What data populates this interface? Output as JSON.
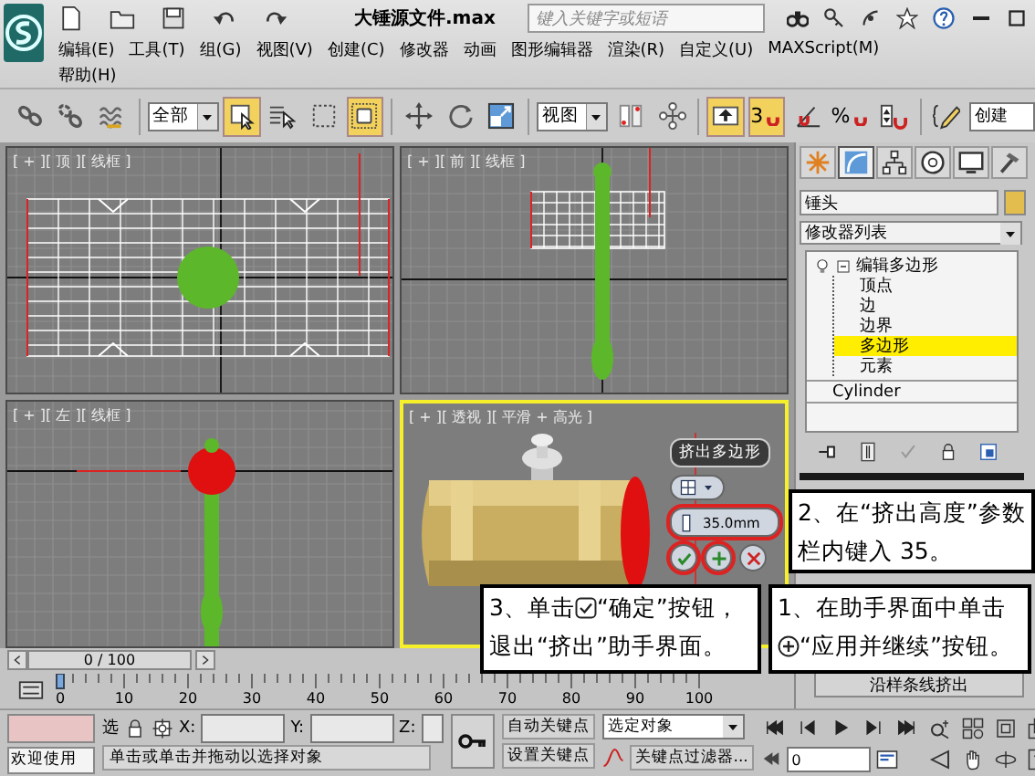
{
  "title_bar": {
    "title": "大锤源文件.max",
    "search": {
      "placeholder": "键入关键字或短语"
    }
  },
  "menu_rows": [
    [
      "编辑(E)",
      "工具(T)",
      "组(G)",
      "视图(V)",
      "创建(C)",
      "修改器",
      "动画",
      "图形编辑器",
      "渲染(R)",
      "自定义(U)",
      "MAXScript(M)"
    ],
    [
      "帮助(H)"
    ]
  ],
  "toolbar": [
    {
      "kind": "link",
      "active": false
    },
    {
      "kind": "unlink",
      "active": false
    },
    {
      "kind": "bind",
      "active": false
    },
    {
      "kind": "dropdown",
      "label": "全部"
    },
    {
      "kind": "select",
      "active": true
    },
    {
      "kind": "select-by-name",
      "active": false
    },
    {
      "kind": "region",
      "active": false
    },
    {
      "kind": "window-crossing",
      "active": true
    },
    {
      "kind": "move",
      "active": false
    },
    {
      "kind": "rotate",
      "active": false
    },
    {
      "kind": "scale",
      "active": false
    },
    {
      "kind": "dropdown",
      "label": "视图"
    },
    {
      "kind": "mirror",
      "active": false
    },
    {
      "kind": "align",
      "active": false
    },
    {
      "kind": "shortcut",
      "active": true
    },
    {
      "kind": "snap",
      "label": "3",
      "active": true
    },
    {
      "kind": "angle-snap",
      "active": false
    },
    {
      "kind": "percent-snap",
      "label": "%",
      "active": false
    },
    {
      "kind": "spinner-snap",
      "active": false
    },
    {
      "kind": "edit-named",
      "active": false
    },
    {
      "kind": "field",
      "label": "创建"
    }
  ],
  "viewports": [
    {
      "kind": "top",
      "label": "[ + ][ 顶 ][ 线框 ]",
      "active": false
    },
    {
      "kind": "front",
      "label": "[ + ][ 前 ][ 线框 ]",
      "active": false
    },
    {
      "kind": "left",
      "label": "[ + ][ 左 ][ 线框 ]",
      "active": false
    },
    {
      "kind": "perspective",
      "label": "[ + ][ 透视 ][ 平滑 + 高光 ]",
      "active": true
    }
  ],
  "caddy": {
    "title": "挤出多边形",
    "height": "35.0mm"
  },
  "time_slider": {
    "position": "0 / 100",
    "level": 0
  },
  "track_bar": {
    "ticks": [
      "0",
      "10",
      "20",
      "30",
      "40",
      "50",
      "60",
      "70",
      "80",
      "90",
      "100"
    ]
  },
  "command_panel": {
    "tabs": [
      {
        "kind": "create",
        "selected": false
      },
      {
        "kind": "modify",
        "selected": true
      },
      {
        "kind": "hierarchy",
        "selected": false
      },
      {
        "kind": "motion",
        "selected": false
      },
      {
        "kind": "display",
        "selected": false
      },
      {
        "kind": "utilities",
        "selected": false
      }
    ],
    "object_name": "锤头",
    "modifier_list": "修改器列表",
    "stack": [
      {
        "label": "编辑多边形",
        "expanded": true,
        "children": [
          {
            "label": "顶点",
            "selected": false
          },
          {
            "label": "边",
            "selected": false
          },
          {
            "label": "边界",
            "selected": false
          },
          {
            "label": "多边形",
            "selected": true
          },
          {
            "label": "元素",
            "selected": false
          }
        ]
      },
      {
        "label": "Cylinder"
      }
    ],
    "extrude_button": "沿样条线挤出"
  },
  "status_bar": {
    "welcome": "欢迎使用",
    "selection_lock": "选",
    "x_label": "X:",
    "y_label": "Y:",
    "z_label": "Z:",
    "prompt": "单击或单击并拖动以选择对象",
    "auto_key": "自动关键点",
    "set_key": "设置关键点",
    "key_target": "选定对象",
    "key_filters": "关键点过滤器...",
    "frame": "0"
  },
  "callouts": [
    {
      "lead": "2、在“挤出高度”参数栏内键入 35。"
    },
    {
      "lead": "3、单击",
      "rest": "“确定”按钮，退出“挤出”助手界面。"
    },
    {
      "lead": "1、在助手界面中单击",
      "rest": "“应用并继续”按钮。"
    }
  ]
}
